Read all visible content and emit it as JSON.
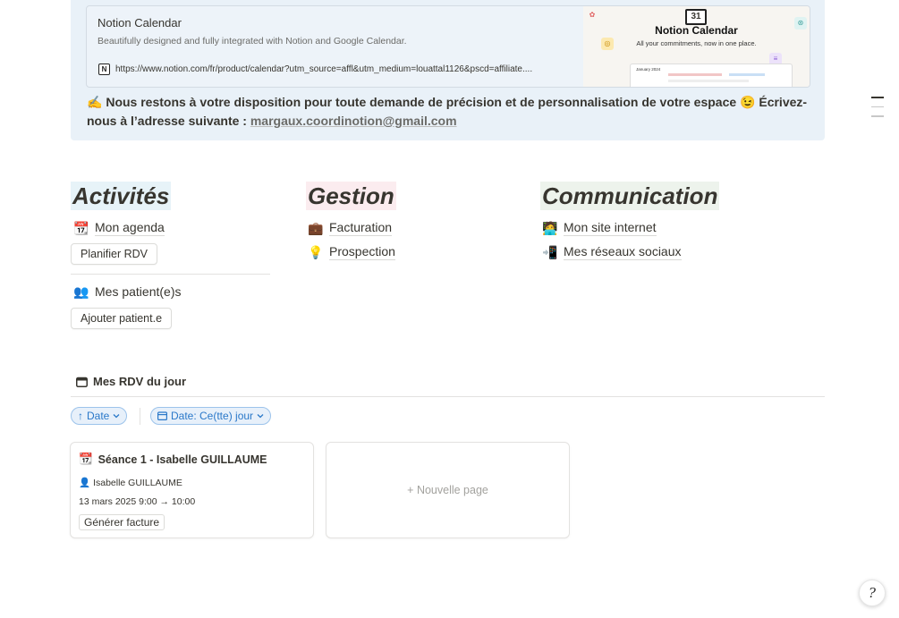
{
  "bookmark": {
    "title": "Notion Calendar",
    "description": "Beautifully designed and fully integrated with Notion and Google Calendar.",
    "url": "https://www.notion.com/fr/product/calendar?utm_source=affl&utm_medium=louattal1126&pscd=affiliate....",
    "thumb": {
      "day": "31",
      "title": "Notion Calendar",
      "subtitle": "All your commitments, now in one place.",
      "screen_month": "January 2024"
    }
  },
  "callout": {
    "emoji": "✍️",
    "text": " Nous restons à votre disposition pour toute demande de précision et de personnalisation de votre espace 😉  Écrivez-nous à l’adresse suivante : ",
    "email": "margaux.coordinotion@gmail.com"
  },
  "columns": {
    "activites": {
      "title": "Activités",
      "agenda": {
        "emoji": "📆",
        "label": "Mon agenda"
      },
      "btn_rdv": "Planifier RDV",
      "patients": {
        "emoji": "👥",
        "label": "Mes patient(e)s"
      },
      "btn_patient": "Ajouter patient.e"
    },
    "gestion": {
      "title": "Gestion",
      "facturation": {
        "emoji": "💼",
        "label": "Facturation"
      },
      "prospection": {
        "emoji": "💡",
        "label": "Prospection"
      }
    },
    "communication": {
      "title": "Communication",
      "site": {
        "emoji": "🧑‍💻",
        "label": "Mon site internet"
      },
      "reseaux": {
        "emoji": "📲",
        "label": "Mes réseaux sociaux"
      }
    }
  },
  "database": {
    "title": "Mes RDV du jour",
    "sort_chip": "Date",
    "filter_chip": "Date: Ce(tte) jour",
    "card": {
      "emoji": "📆",
      "title": "Séance 1 - Isabelle GUILLAUME",
      "person": "Isabelle GUILLAUME",
      "date": "13 mars 2025 9:00 → 10:00",
      "tag": "Générer facture"
    },
    "new_page": "Nouvelle page"
  },
  "help": "?"
}
